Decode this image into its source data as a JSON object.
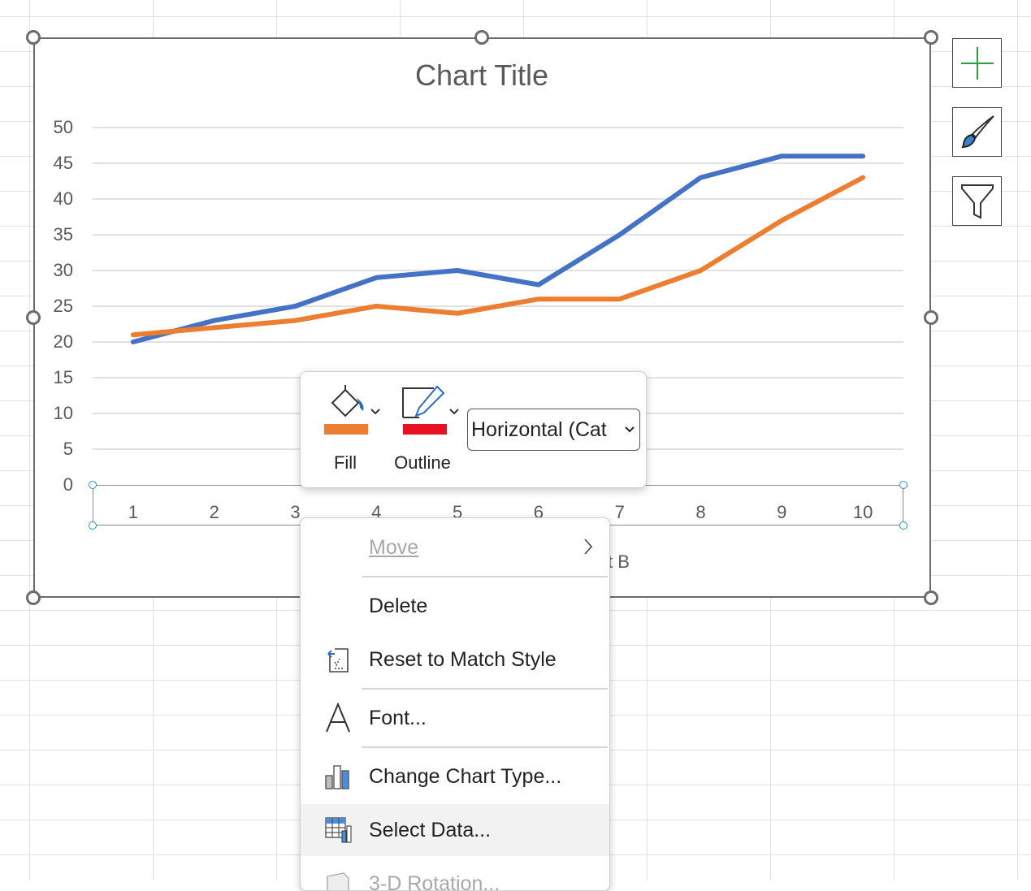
{
  "chart": {
    "title": "Chart Title",
    "axis_title_partial": "ct B"
  },
  "chart_data": {
    "type": "line",
    "title": "Chart Title",
    "x": [
      1,
      2,
      3,
      4,
      5,
      6,
      7,
      8,
      9,
      10
    ],
    "ylim": [
      0,
      50
    ],
    "yticks": [
      0,
      5,
      10,
      15,
      20,
      25,
      30,
      35,
      40,
      45,
      50
    ],
    "grid": true,
    "series": [
      {
        "color": "#4472C4",
        "values": [
          20,
          23,
          25,
          29,
          30,
          28,
          35,
          43,
          46,
          46
        ]
      },
      {
        "color": "#ED7D31",
        "values": [
          21,
          22,
          23,
          25,
          24,
          26,
          26,
          30,
          37,
          43
        ]
      }
    ]
  },
  "side_buttons": [
    {
      "icon": "plus-icon"
    },
    {
      "icon": "paintbrush-icon"
    },
    {
      "icon": "filter-icon"
    }
  ],
  "mini_toolbar": {
    "fill_label": "Fill",
    "fill_color": "#ED7D31",
    "outline_label": "Outline",
    "outline_color": "#E81123",
    "element_selector": "Horizontal (Cat"
  },
  "context_menu": {
    "items": [
      {
        "label": "Move",
        "disabled": true,
        "submenu": true
      },
      {
        "label": "Delete"
      },
      {
        "label": "Reset to Match Style",
        "icon": "reset-style-icon"
      },
      {
        "label": "Font...",
        "icon": "font-icon"
      },
      {
        "label": "Change Chart Type...",
        "icon": "chart-type-icon"
      },
      {
        "label": "Select Data...",
        "icon": "select-data-icon",
        "highlighted": true
      },
      {
        "label": "3-D Rotation...",
        "icon": "3d-rotation-icon",
        "disabled": true
      }
    ]
  }
}
